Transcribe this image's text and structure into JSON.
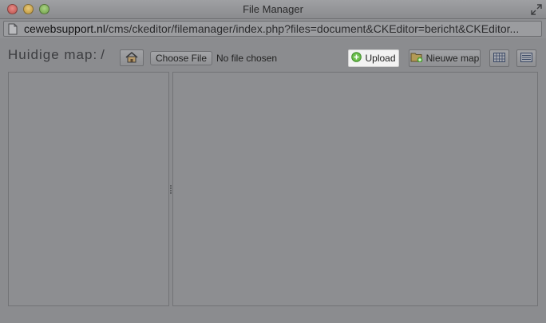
{
  "window": {
    "title": "File Manager"
  },
  "address_bar": {
    "host": "cewebsupport.nl",
    "path": "/cms/ckeditor/filemanager/index.php?files=document&CKEditor=bericht&CKEditor..."
  },
  "toolbar": {
    "current_dir_label": "Huidige map:",
    "current_dir_path": "/",
    "choose_file_label": "Choose File",
    "file_status": "No file chosen",
    "upload_label": "Upload",
    "new_folder_label": "Nieuwe map"
  },
  "icons": {
    "home": "home-icon",
    "upload": "add-circle-icon",
    "new_folder": "folder-add-icon",
    "grid_view": "grid-view-icon",
    "list_view": "list-view-icon",
    "document": "document-icon",
    "resize": "resize-icon"
  },
  "colors": {
    "close": "#e0625c",
    "minimize": "#e0b44a",
    "maximize": "#7ec250",
    "upload_bg": "#f2f2f2"
  }
}
